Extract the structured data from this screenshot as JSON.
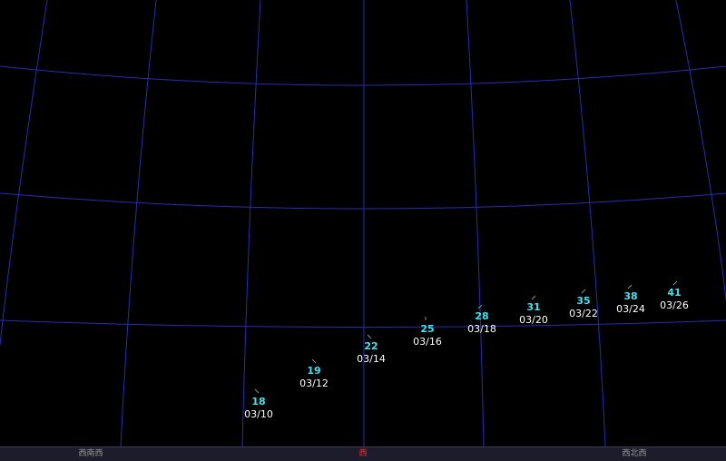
{
  "compass": {
    "left_label": "西南西",
    "center_label": "西",
    "right_label": "西北西"
  },
  "colors": {
    "background": "#000000",
    "grid": "#2a2ab8",
    "altitude_text": "#3fe3ee",
    "date_text": "#ffffff",
    "main_direction": "#ff3030"
  },
  "markers": [
    {
      "altitude": "18",
      "date": "03/10"
    },
    {
      "altitude": "19",
      "date": "03/12"
    },
    {
      "altitude": "22",
      "date": "03/14"
    },
    {
      "altitude": "25",
      "date": "03/16"
    },
    {
      "altitude": "28",
      "date": "03/18"
    },
    {
      "altitude": "31",
      "date": "03/20"
    },
    {
      "altitude": "35",
      "date": "03/22"
    },
    {
      "altitude": "38",
      "date": "03/24"
    },
    {
      "altitude": "41",
      "date": "03/26"
    }
  ]
}
